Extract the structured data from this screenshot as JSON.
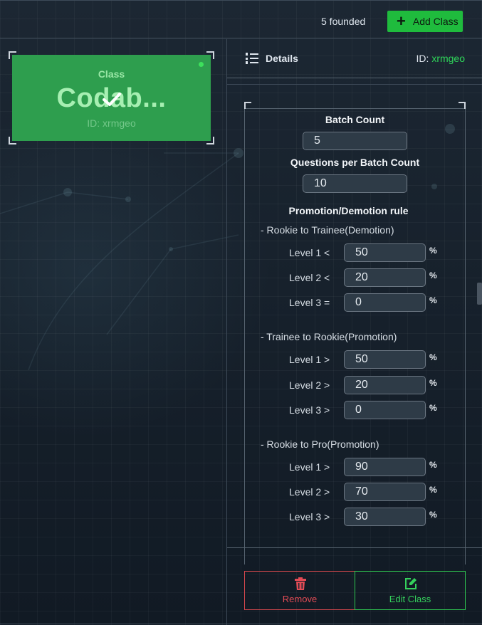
{
  "topbar": {
    "found_text": "5 founded",
    "add_button_label": "Add Class"
  },
  "class_card": {
    "label": "Class",
    "name": "Codab...",
    "id_text": "ID: xrmgeo",
    "accent": "#2e9e4e"
  },
  "details": {
    "title": "Details",
    "id_label": "ID: ",
    "id_value": "xrmgeo"
  },
  "form": {
    "batch_count_label": "Batch Count",
    "batch_count_value": "5",
    "questions_label": "Questions per Batch Count",
    "questions_value": "10",
    "rule_heading": "Promotion/Demotion rule",
    "sections": [
      {
        "title": "- Rookie to Trainee(Demotion)",
        "levels": [
          {
            "label": "Level 1 <",
            "value": "50",
            "unit": "%"
          },
          {
            "label": "Level 2 <",
            "value": "20",
            "unit": "%"
          },
          {
            "label": "Level 3 =",
            "value": "0",
            "unit": "%"
          }
        ]
      },
      {
        "title": "- Trainee to Rookie(Promotion)",
        "levels": [
          {
            "label": "Level 1 >",
            "value": "50",
            "unit": "%"
          },
          {
            "label": "Level 2 >",
            "value": "20",
            "unit": "%"
          },
          {
            "label": "Level 3 >",
            "value": "0",
            "unit": "%"
          }
        ]
      },
      {
        "title": "- Rookie to Pro(Promotion)",
        "levels": [
          {
            "label": "Level 1 >",
            "value": "90",
            "unit": "%"
          },
          {
            "label": "Level 2 >",
            "value": "70",
            "unit": "%"
          },
          {
            "label": "Level 3 >",
            "value": "30",
            "unit": "%"
          }
        ]
      }
    ]
  },
  "actions": {
    "remove_label": "Remove",
    "edit_label": "Edit Class",
    "remove_color": "#e34b55",
    "edit_color": "#35d15c"
  },
  "icons": {
    "add": "plus-icon",
    "details": "list-ordered-icon",
    "remove": "trash-icon",
    "edit": "edit-icon",
    "selected": "check-icon"
  }
}
